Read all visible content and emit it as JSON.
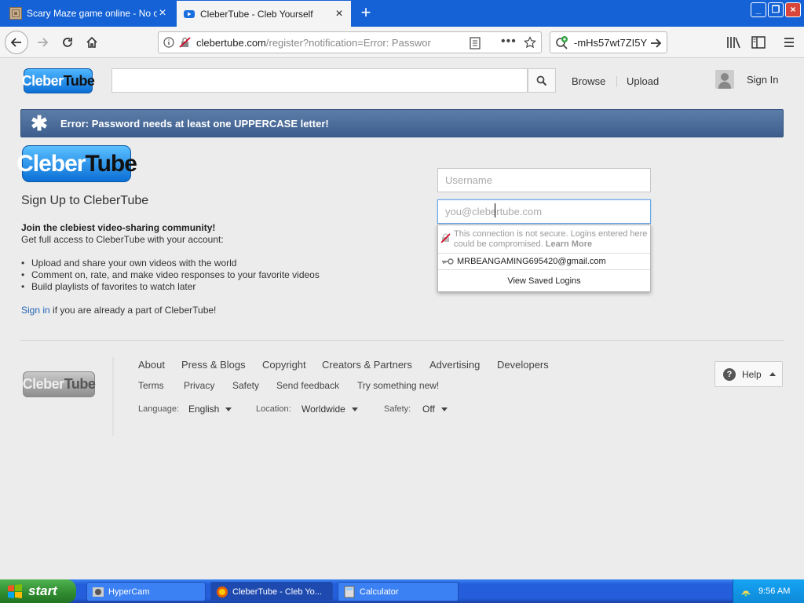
{
  "browser": {
    "tabs": [
      {
        "label": "Scary Maze game online - No over",
        "active": false
      },
      {
        "label": "CleberTube - Cleb Yourself",
        "active": true
      }
    ],
    "url_host": "clebertube.com",
    "url_path": "/register?notification=Error: Passwor",
    "search_value": "-mHs57wt7ZI5Y"
  },
  "header": {
    "logo_main": "Cleber",
    "logo_tail": "Tube",
    "browse": "Browse",
    "upload": "Upload",
    "signin": "Sign In"
  },
  "error": {
    "message": "Error: Password needs at least one UPPERCASE letter!",
    "color": "#4a6b9a"
  },
  "signup": {
    "title": "Sign Up to CleberTube",
    "join_bold": "Join the clebiest video-sharing community!",
    "join_sub": "Get full access to CleberTube with your account:",
    "bullets": [
      "Upload and share your own videos with the world",
      "Comment on, rate, and make video responses to your favorite videos",
      "Build playlists of favorites to watch later"
    ],
    "signin_link": "Sign in",
    "signin_rest": " if you are already a part of CleberTube!"
  },
  "form": {
    "username_placeholder": "Username",
    "email_placeholder": "you@clebertube.com"
  },
  "autofill": {
    "warning": "This connection is not secure. Logins entered here could be compromised.",
    "learn_more": "Learn More",
    "login": "MRBEANGAMING695420@gmail.com",
    "view_saved": "View Saved Logins"
  },
  "footer": {
    "row1": [
      "About",
      "Press & Blogs",
      "Copyright",
      "Creators & Partners",
      "Advertising",
      "Developers"
    ],
    "row2": [
      "Terms",
      "Privacy",
      "Safety",
      "Send feedback",
      "Try something new!"
    ],
    "language_label": "Language:",
    "language_value": "English",
    "location_label": "Location:",
    "location_value": "Worldwide",
    "safety_label": "Safety:",
    "safety_value": "Off",
    "help": "Help"
  },
  "taskbar": {
    "start": "start",
    "tasks": [
      "HyperCam",
      "CleberTube - Cleb Yo...",
      "Calculator"
    ],
    "clock": "9:56 AM"
  }
}
